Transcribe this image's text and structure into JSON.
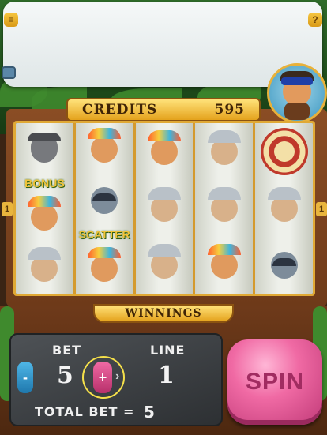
{
  "header": {
    "menu_icon": "menu-icon",
    "help_label": "?",
    "video_icon": "tv-icon"
  },
  "credits": {
    "label": "CREDITS",
    "value": "595"
  },
  "reels": [
    {
      "symbols": [
        "wolf",
        "chief",
        "knight"
      ],
      "label_row": "BONUS"
    },
    {
      "symbols": [
        "chief",
        "raccoon",
        "chief"
      ],
      "label_row": "SCATTER"
    },
    {
      "symbols": [
        "chief",
        "knight",
        "knight"
      ],
      "label_row": ""
    },
    {
      "symbols": [
        "knight",
        "knight",
        "chief"
      ],
      "label_row": ""
    },
    {
      "symbols": [
        "shield",
        "knight",
        "raccoon"
      ],
      "label_row": ""
    }
  ],
  "side_markers": {
    "left": "1",
    "right": "1"
  },
  "winnings": {
    "label": "WINNINGS"
  },
  "controls": {
    "bet_label": "BET",
    "bet_value": "5",
    "line_label": "LINE",
    "line_value": "1",
    "total_bet_label": "TOTAL BET =",
    "total_bet_value": "5",
    "minus_label": "-",
    "plus_label": "+",
    "spin_label": "SPIN"
  },
  "colors": {
    "accent": "#e4a21c",
    "spin": "#f06aa4",
    "minus": "#1f78ad"
  }
}
